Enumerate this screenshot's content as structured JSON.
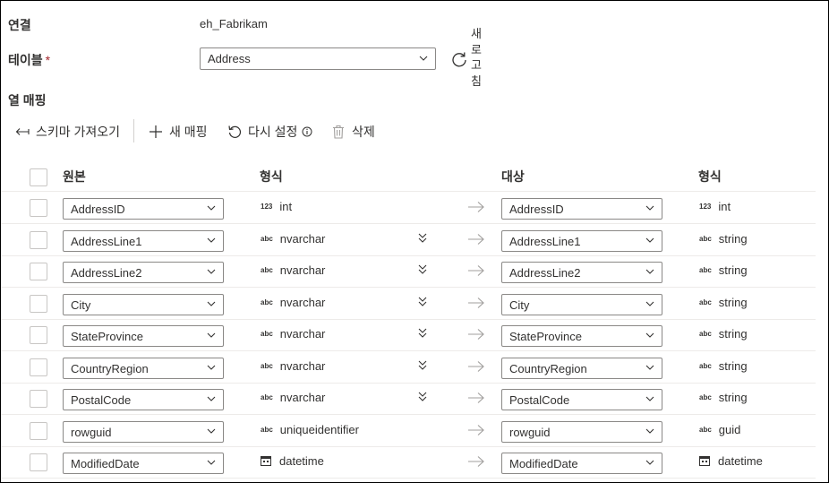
{
  "connection": {
    "label": "연결",
    "value": "eh_Fabrikam"
  },
  "table": {
    "label": "테이블",
    "required_mark": "*",
    "selected": "Address",
    "refresh_label": "새로고침"
  },
  "column_mapping": {
    "title": "열 매핑"
  },
  "toolbar": {
    "import_schema": "스키마 가져오기",
    "new_mapping": "새 매핑",
    "reset": "다시 설정",
    "delete": "삭제"
  },
  "grid": {
    "headers": {
      "source": "원본",
      "source_type": "형식",
      "destination": "대상",
      "destination_type": "형식"
    },
    "rows": [
      {
        "source": "AddressID",
        "source_type_icon": "123",
        "source_type": "int",
        "expandable": false,
        "destination": "AddressID",
        "destination_type_icon": "123",
        "destination_type": "int"
      },
      {
        "source": "AddressLine1",
        "source_type_icon": "abc",
        "source_type": "nvarchar",
        "expandable": true,
        "destination": "AddressLine1",
        "destination_type_icon": "abc",
        "destination_type": "string"
      },
      {
        "source": "AddressLine2",
        "source_type_icon": "abc",
        "source_type": "nvarchar",
        "expandable": true,
        "destination": "AddressLine2",
        "destination_type_icon": "abc",
        "destination_type": "string"
      },
      {
        "source": "City",
        "source_type_icon": "abc",
        "source_type": "nvarchar",
        "expandable": true,
        "destination": "City",
        "destination_type_icon": "abc",
        "destination_type": "string"
      },
      {
        "source": "StateProvince",
        "source_type_icon": "abc",
        "source_type": "nvarchar",
        "expandable": true,
        "destination": "StateProvince",
        "destination_type_icon": "abc",
        "destination_type": "string"
      },
      {
        "source": "CountryRegion",
        "source_type_icon": "abc",
        "source_type": "nvarchar",
        "expandable": true,
        "destination": "CountryRegion",
        "destination_type_icon": "abc",
        "destination_type": "string"
      },
      {
        "source": "PostalCode",
        "source_type_icon": "abc",
        "source_type": "nvarchar",
        "expandable": true,
        "destination": "PostalCode",
        "destination_type_icon": "abc",
        "destination_type": "string"
      },
      {
        "source": "rowguid",
        "source_type_icon": "abc",
        "source_type": "uniqueidentifier",
        "expandable": false,
        "destination": "rowguid",
        "destination_type_icon": "abc",
        "destination_type": "guid"
      },
      {
        "source": "ModifiedDate",
        "source_type_icon": "calendar-icon",
        "source_type": "datetime",
        "expandable": false,
        "destination": "ModifiedDate",
        "destination_type_icon": "calendar-icon",
        "destination_type": "datetime"
      }
    ]
  },
  "colors": {
    "text": "#323130",
    "border": "#8a8886",
    "divider": "#edebe9",
    "arrow": "#a19f9d",
    "required": "#a4262c"
  }
}
